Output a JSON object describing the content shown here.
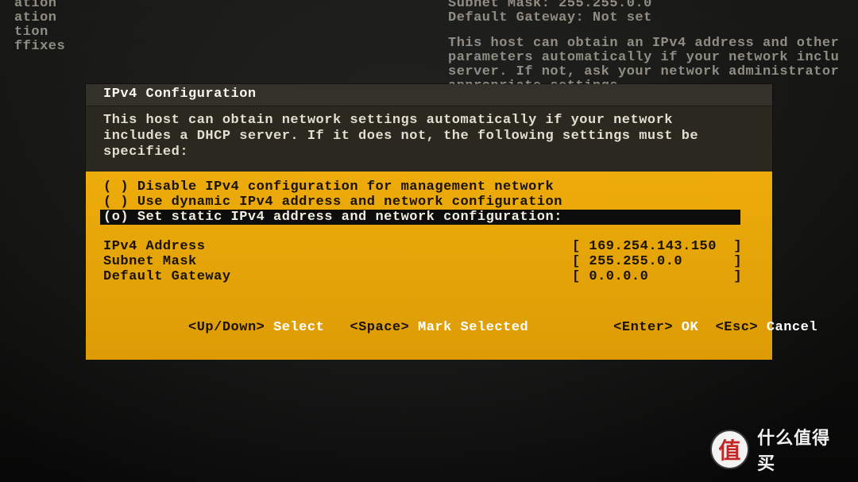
{
  "background": {
    "left_lines": "ation\nation\ntion\nffixes",
    "right_line1": "Subnet Mask: 255.255.0.0\nDefault Gateway: Not set",
    "right_block": "This host can obtain an IPv4 address and other\nparameters automatically if your network inclu\nserver. If not, ask your network administrator\nappropriate settings."
  },
  "dialog": {
    "title": "IPv4 Configuration",
    "description": "This host can obtain network settings automatically if your network\nincludes a DHCP server. If it does not, the following settings must be\nspecified:",
    "options": [
      {
        "marker": "( )",
        "label": "Disable IPv4 configuration for management network",
        "selected": false
      },
      {
        "marker": "( )",
        "label": "Use dynamic IPv4 address and network configuration",
        "selected": false
      },
      {
        "marker": "(o)",
        "label": "Set static IPv4 address and network configuration:",
        "selected": true
      }
    ],
    "fields": [
      {
        "label": "IPv4 Address",
        "value": "169.254.143.150"
      },
      {
        "label": "Subnet Mask",
        "value": "255.255.0.0"
      },
      {
        "label": "Default Gateway",
        "value": "0.0.0.0"
      }
    ],
    "hints": {
      "updown_key": "<Up/Down>",
      "updown_lbl": "Select",
      "space_key": "<Space>",
      "space_lbl": "Mark Selected",
      "enter_key": "<Enter>",
      "enter_lbl": "OK",
      "esc_key": "<Esc>",
      "esc_lbl": "Cancel"
    }
  },
  "watermark": {
    "icon": "值",
    "text": "什么值得买"
  }
}
